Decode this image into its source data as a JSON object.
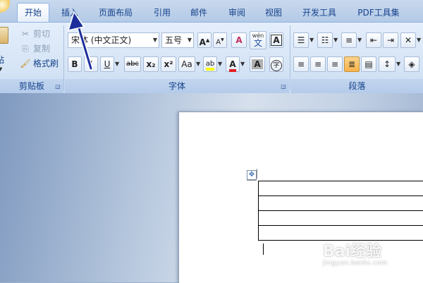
{
  "tabs": [
    "开始",
    "插入",
    "页面布局",
    "引用",
    "邮件",
    "审阅",
    "视图",
    "开发工具",
    "PDF工具集"
  ],
  "active_tab": "开始",
  "clipboard": {
    "label": "剪贴板",
    "paste_label": "贴",
    "cut_label": "剪切",
    "copy_label": "复制",
    "format_painter_label": "格式刷"
  },
  "font": {
    "label": "字体",
    "font_name": "宋体 (中文正文)",
    "font_size": "五号",
    "bold": "B",
    "italic": "I",
    "underline": "U",
    "strikethrough": "abc",
    "subscript": "x₂",
    "superscript": "x²",
    "change_case": "Aa",
    "grow_font": "A",
    "shrink_font": "A",
    "phonetic_guide_top": "wén",
    "phonetic_guide_char": "文",
    "char_border": "A",
    "clear_format": "A",
    "char_shading": "A",
    "enclose_char": "字",
    "highlight_text": "ab",
    "font_color_char": "A",
    "highlight_color": "#ffff00",
    "font_color": "#e02020"
  },
  "paragraph": {
    "label": "段落"
  },
  "watermark": {
    "brand": "Bai经验",
    "url": "jingyan.baidu.com"
  }
}
